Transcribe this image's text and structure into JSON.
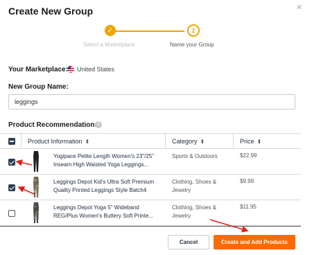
{
  "modal": {
    "title": "Create New Group",
    "close_glyph": "×"
  },
  "stepper": {
    "steps": [
      {
        "label": "Select a Marketplace",
        "marker": "✓",
        "state": "done"
      },
      {
        "label": "Name your Group",
        "marker": "2",
        "state": "active"
      }
    ],
    "accent_color": "#f0a500"
  },
  "marketplace": {
    "label": "Your Marketplace:",
    "flag_icon": "us-flag-icon",
    "value": "United States"
  },
  "group_name": {
    "label": "New Group Name:",
    "value": "leggings"
  },
  "recommendations": {
    "label": "Product Recommendations",
    "info_glyph": "i",
    "columns": [
      {
        "label": "Product Information",
        "sort_glyph": "⬍"
      },
      {
        "label": "Category",
        "sort_glyph": "⬍"
      },
      {
        "label": "Price",
        "sort_glyph": "⬍"
      }
    ],
    "rows": [
      {
        "checked": true,
        "name": "Yogipace Petite Length Women's 23\"/25\" Inseam High Waisted Yoga Leggings...",
        "category": "Sports & Outdoors",
        "price": "$22.99"
      },
      {
        "checked": true,
        "name": "Leggings Depot Kid's Ultra Soft Premium Quality Printed Leggings Style Batch4",
        "category": "Clothing, Shoes & Jewelry",
        "price": "$9.99"
      },
      {
        "checked": false,
        "name": "Leggings Depot Yoga 5\" Wideband REG/Plus Women's Buttery Soft Printe...",
        "category": "Clothing, Shoes & Jewelry",
        "price": "$11.95"
      }
    ]
  },
  "footer": {
    "cancel_label": "Cancel",
    "create_label": "Create and Add Products",
    "create_color": "#ff6a00"
  },
  "annotation_color": "#e0201b"
}
